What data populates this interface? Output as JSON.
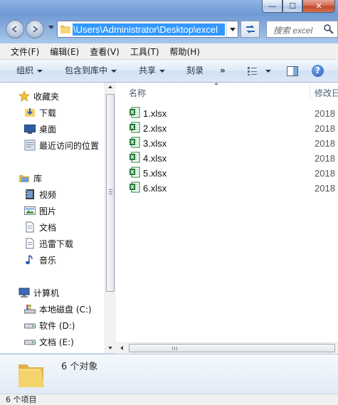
{
  "window": {
    "minimize_glyph": "—",
    "maximize_glyph": "☐",
    "close_glyph": "✕"
  },
  "nav": {
    "address": "\\Users\\Administrator\\Desktop\\excel",
    "search_placeholder": "搜索 excel"
  },
  "menu": [
    "文件(F)",
    "编辑(E)",
    "查看(V)",
    "工具(T)",
    "帮助(H)"
  ],
  "toolbar": {
    "organize": "组织",
    "include_in_library": "包含到库中",
    "share": "共享",
    "burn": "刻录",
    "more": "»",
    "help": "?"
  },
  "sidebar": {
    "favorites": {
      "label": "收藏夹",
      "items": [
        "下载",
        "桌面",
        "最近访问的位置"
      ]
    },
    "libraries": {
      "label": "库",
      "items": [
        "视频",
        "图片",
        "文档",
        "迅雷下载",
        "音乐"
      ]
    },
    "computer": {
      "label": "计算机",
      "items": [
        "本地磁盘 (C:)",
        "软件 (D:)",
        "文档 (E:)"
      ]
    }
  },
  "columns": {
    "name": "名称",
    "date_modified": "修改日"
  },
  "files": [
    {
      "name": "1.xlsx",
      "date": "2018"
    },
    {
      "name": "2.xlsx",
      "date": "2018"
    },
    {
      "name": "3.xlsx",
      "date": "2018"
    },
    {
      "name": "4.xlsx",
      "date": "2018"
    },
    {
      "name": "5.xlsx",
      "date": "2018"
    },
    {
      "name": "6.xlsx",
      "date": "2018"
    }
  ],
  "details": {
    "count": "6 个对象"
  },
  "status": {
    "text": "6 个项目"
  },
  "colors": {
    "selection": "#3399ff",
    "excel_green": "#1e7b34",
    "folder_yellow": "#f3d36b"
  }
}
